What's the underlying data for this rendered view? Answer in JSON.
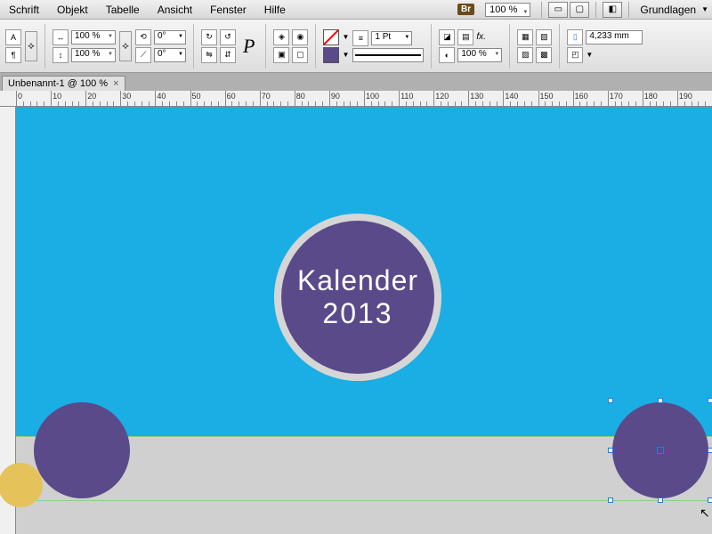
{
  "menu": {
    "items": [
      "Schrift",
      "Objekt",
      "Tabelle",
      "Ansicht",
      "Fenster",
      "Hilfe"
    ],
    "br": "Br",
    "zoom": "100 %",
    "workspace": "Grundlagen"
  },
  "toolbar": {
    "scaleX": "100 %",
    "scaleY": "100 %",
    "rotate": "0°",
    "shear": "0°",
    "strokePt": "1 Pt",
    "opacity": "100 %",
    "dim": "4,233 mm",
    "big_p": "P"
  },
  "doc": {
    "tab_title": "Unbenannt-1 @ 100 %",
    "tab_close": "×"
  },
  "ruler": {
    "start": 0,
    "end": 200,
    "step": 10
  },
  "artwork": {
    "title_line1": "Kalender",
    "title_line2": "2013"
  }
}
